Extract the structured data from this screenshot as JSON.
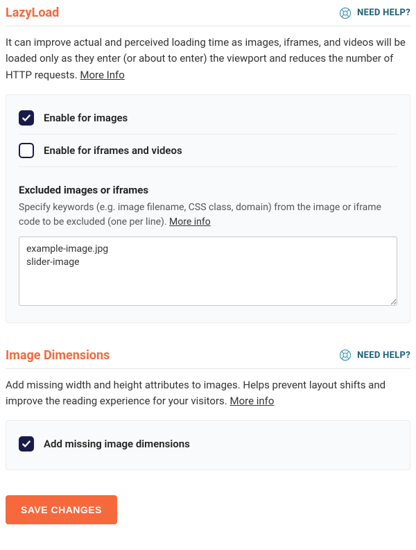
{
  "lazyload": {
    "title": "LazyLoad",
    "help_label": "NEED HELP?",
    "description": "It can improve actual and perceived loading time as images, iframes, and videos will be loaded only as they enter (or about to enter) the viewport and reduces the number of HTTP requests. ",
    "more_info": "More Info",
    "options": {
      "images": {
        "label": "Enable for images",
        "checked": true
      },
      "iframes": {
        "label": "Enable for iframes and videos",
        "checked": false
      }
    },
    "excluded": {
      "heading": "Excluded images or iframes",
      "desc": "Specify keywords (e.g. image filename, CSS class, domain) from the image or iframe code to be excluded (one per line). ",
      "more_info": "More info",
      "value": "example-image.jpg\nslider-image"
    }
  },
  "dimensions": {
    "title": "Image Dimensions",
    "help_label": "NEED HELP?",
    "description": "Add missing width and height attributes to images. Helps prevent layout shifts and improve the reading experience for your visitors. ",
    "more_info": "More info",
    "options": {
      "add_missing": {
        "label": "Add missing image dimensions",
        "checked": true
      }
    }
  },
  "save_label": "SAVE CHANGES"
}
